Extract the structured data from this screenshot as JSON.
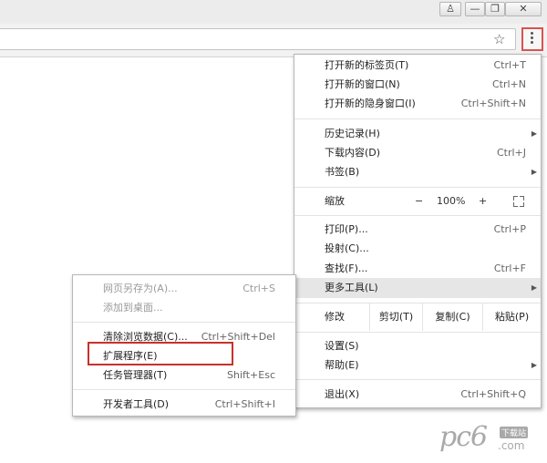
{
  "window": {
    "buttons": {
      "user": "♙",
      "minimize": "—",
      "maximize": "❐",
      "close": "✕"
    }
  },
  "toolbar": {
    "star_icon": "☆",
    "menu_button": "more-vert-icon"
  },
  "menu": {
    "items": [
      {
        "label": "打开新的标签页(T)",
        "shortcut": "Ctrl+T"
      },
      {
        "label": "打开新的窗口(N)",
        "shortcut": "Ctrl+N"
      },
      {
        "label": "打开新的隐身窗口(I)",
        "shortcut": "Ctrl+Shift+N"
      },
      {
        "label": "历史记录(H)",
        "shortcut": ""
      },
      {
        "label": "下载内容(D)",
        "shortcut": "Ctrl+J"
      },
      {
        "label": "书签(B)",
        "shortcut": ""
      },
      {
        "label": "打印(P)...",
        "shortcut": "Ctrl+P"
      },
      {
        "label": "投射(C)...",
        "shortcut": ""
      },
      {
        "label": "查找(F)...",
        "shortcut": "Ctrl+F"
      },
      {
        "label": "更多工具(L)",
        "shortcut": ""
      },
      {
        "label": "设置(S)",
        "shortcut": ""
      },
      {
        "label": "帮助(E)",
        "shortcut": ""
      },
      {
        "label": "退出(X)",
        "shortcut": "Ctrl+Shift+Q"
      }
    ],
    "zoom": {
      "label": "缩放",
      "minus": "−",
      "value": "100%",
      "plus": "+"
    },
    "edit": {
      "label": "修改",
      "cut": "剪切(T)",
      "copy": "复制(C)",
      "paste": "粘贴(P)"
    }
  },
  "submenu": {
    "items": [
      {
        "label": "网页另存为(A)...",
        "shortcut": "Ctrl+S"
      },
      {
        "label": "添加到桌面...",
        "shortcut": ""
      },
      {
        "label": "清除浏览数据(C)...",
        "shortcut": "Ctrl+Shift+Del"
      },
      {
        "label": "扩展程序(E)",
        "shortcut": ""
      },
      {
        "label": "任务管理器(T)",
        "shortcut": "Shift+Esc"
      },
      {
        "label": "开发者工具(D)",
        "shortcut": "Ctrl+Shift+I"
      }
    ]
  },
  "watermark": {
    "brand": "pc6",
    "tag": "下载站",
    "domain": ".com"
  }
}
